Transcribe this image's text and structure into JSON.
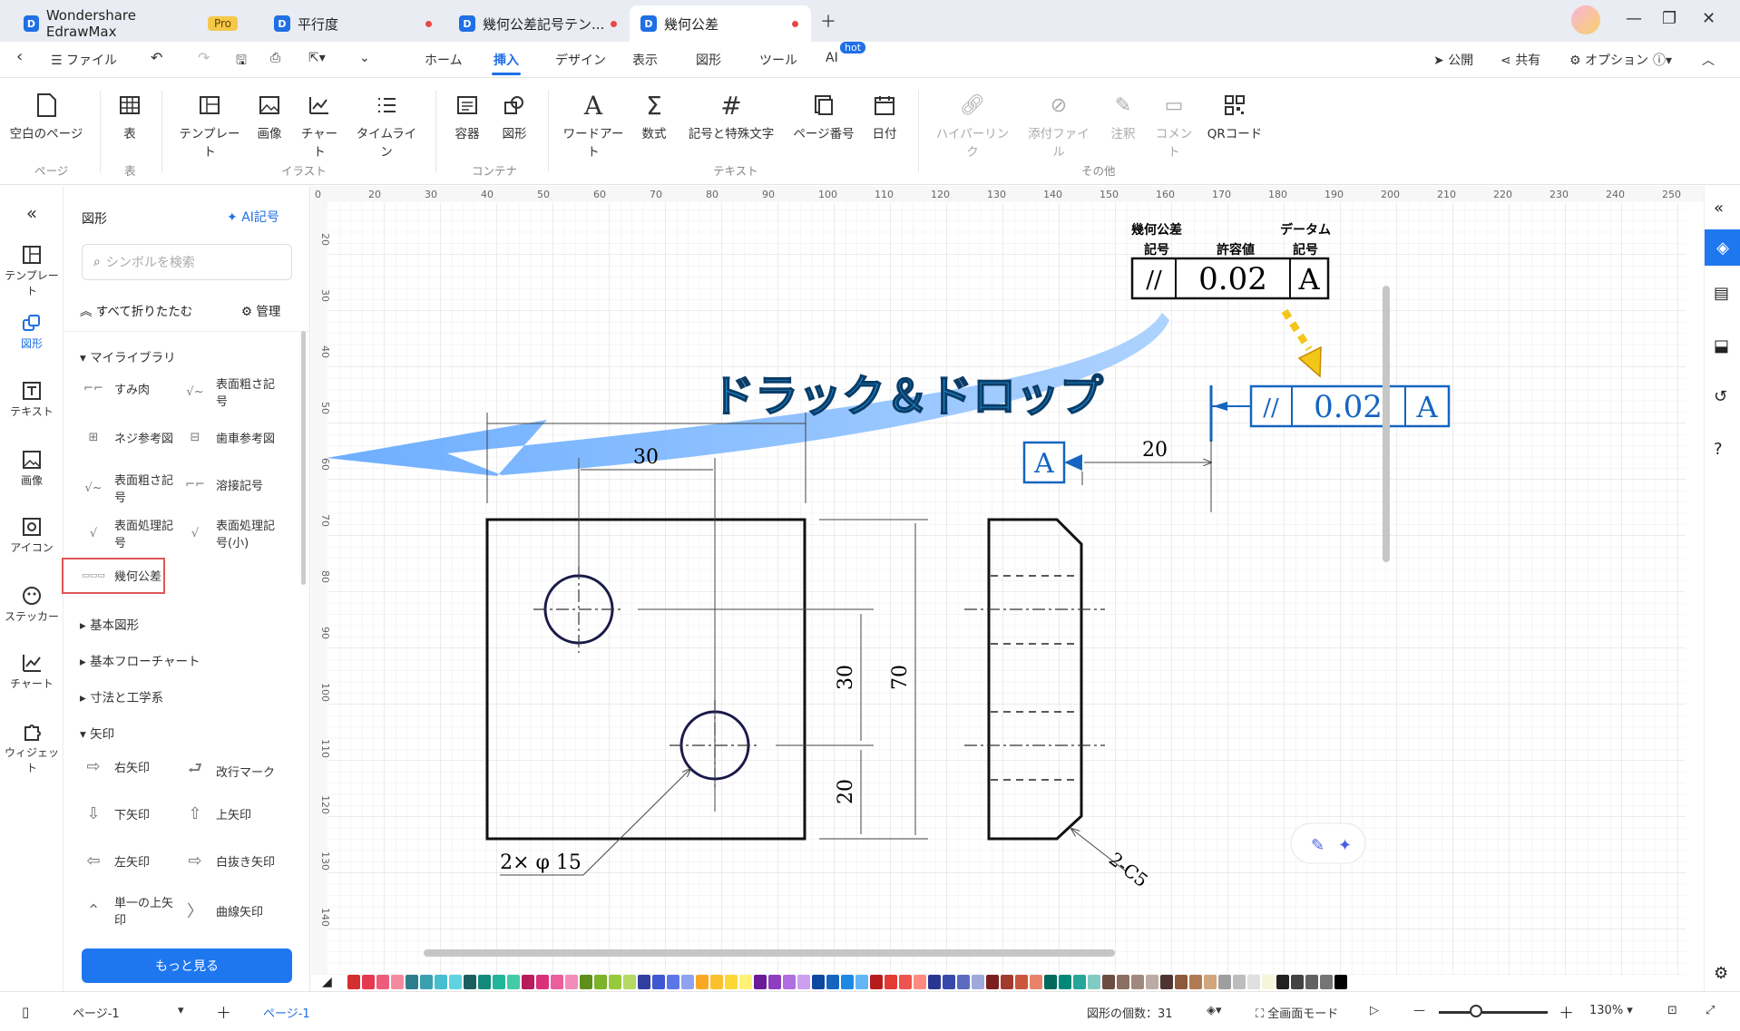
{
  "app": {
    "name": "Wondershare EdrawMax",
    "badge": "Pro",
    "tabs": [
      {
        "label": "平行度"
      },
      {
        "label": "幾何公差記号テン..."
      },
      {
        "label": "幾何公差"
      }
    ]
  },
  "menu": {
    "file": "ファイル",
    "items": [
      "ホーム",
      "挿入",
      "デザイン",
      "表示",
      "図形",
      "ツール",
      "AI"
    ],
    "ai_badge": "hot",
    "right": {
      "publish": "公開",
      "share": "共有",
      "options": "オプション"
    }
  },
  "ribbon": {
    "buttons": {
      "blank_page": "空白のページ",
      "table": "表",
      "template": "テンプレート",
      "image": "画像",
      "chart": "チャート",
      "timeline": "タイムライン",
      "container": "容器",
      "shape": "図形",
      "wordart": "ワードアート",
      "formula": "数式",
      "symbols": "記号と特殊文字",
      "page_number": "ページ番号",
      "date": "日付",
      "hyperlink": "ハイパーリンク",
      "attachment": "添付ファイル",
      "annotation": "注釈",
      "comment": "コメント",
      "qrcode": "QRコード"
    },
    "groups": {
      "page": "ページ",
      "table": "表",
      "illust": "イラスト",
      "container": "コンテナ",
      "text": "テキスト",
      "other": "その他"
    }
  },
  "leftbar": [
    "テンプレート",
    "図形",
    "テキスト",
    "画像",
    "アイコン",
    "ステッカー",
    "チャート",
    "ウィジェット"
  ],
  "panel": {
    "title": "図形",
    "ai_label": "AI記号",
    "search_placeholder": "シンボルを検索",
    "collapse_all": "すべて折りたたむ",
    "manage": "管理",
    "my_library": "マイライブラリ",
    "my_items": [
      "すみ肉",
      "表面粗さ記号",
      "ネジ参考図",
      "歯車参考図",
      "表面粗さ記号",
      "溶接記号",
      "表面処理記号",
      "表面処理記号(小)",
      "幾何公差"
    ],
    "sections": [
      "基本図形",
      "基本フローチャート",
      "寸法と工学系",
      "矢印"
    ],
    "arrow_items": [
      "右矢印",
      "改行マーク",
      "下矢印",
      "上矢印",
      "左矢印",
      "白抜き矢印",
      "単一の上矢印",
      "曲線矢印"
    ],
    "more": "もっと見る"
  },
  "ruler": {
    "h": [
      "0",
      "20",
      "30",
      "40",
      "50",
      "60",
      "70",
      "80",
      "90",
      "100",
      "110",
      "120",
      "130",
      "140",
      "150",
      "160",
      "170",
      "180",
      "190",
      "200",
      "210",
      "220",
      "230",
      "240",
      "250"
    ],
    "v": [
      "20",
      "30",
      "40",
      "50",
      "60",
      "70",
      "80",
      "90",
      "100",
      "110",
      "120",
      "130",
      "140"
    ]
  },
  "drawing": {
    "legend": {
      "symbol_label_1": "幾何公差",
      "symbol_label_2": "記号",
      "tolerance_label": "許容値",
      "datum_label_1": "データム",
      "datum_label_2": "記号"
    },
    "frame_symbol": "//",
    "frame_value": "0.02",
    "frame_datum": "A",
    "overlay_text": "ドラック＆ドロップ",
    "datum_box": "A",
    "dims": {
      "top_width": "30",
      "right_gap": "20",
      "v30": "30",
      "v70": "70",
      "v20": "20",
      "hole_note": "2× φ 15",
      "chamfer": "2-C5"
    }
  },
  "status": {
    "page_select": "ページ-1",
    "page_tab": "ページ-1",
    "shape_count": "図形の個数：31",
    "fullscreen": "全画面モード",
    "zoom": "130%"
  },
  "palette": [
    "#d32f2f",
    "#e53950",
    "#ef5b7a",
    "#f48aa0",
    "#2e7d8c",
    "#3aa0b0",
    "#47bdd0",
    "#60d3e0",
    "#1b5e60",
    "#138a7a",
    "#22b59a",
    "#43cba6",
    "#b71c5c",
    "#d8317a",
    "#ec5e9c",
    "#f28db8",
    "#5d8f1a",
    "#7cb32a",
    "#97c93c",
    "#b5d863",
    "#303f9f",
    "#3f57d0",
    "#5a77e8",
    "#8ea3f0",
    "#f9a825",
    "#fbc02d",
    "#fdd835",
    "#fff176",
    "#6a1b9a",
    "#8e3fc0",
    "#b06ee0",
    "#cc9ff0",
    "#0d47a1",
    "#1565c0",
    "#1e88e5",
    "#64b5f6",
    "#b71c1c",
    "#e53935",
    "#ef5350",
    "#ff8a80",
    "#283593",
    "#3949ab",
    "#5c6bc0",
    "#9fa8da",
    "#7b1f1f",
    "#a13b2b",
    "#c9573e",
    "#e8836a",
    "#00695c",
    "#00897b",
    "#26a69a",
    "#80cbc4",
    "#6d4c41",
    "#8d6e63",
    "#a1887f",
    "#bcaaa4",
    "#4e342e",
    "#8d5b3b",
    "#b07a55",
    "#d2a57f",
    "#9e9e9e",
    "#bdbdbd",
    "#e0e0e0",
    "#f5f5dc",
    "#212121",
    "#424242",
    "#616161",
    "#757575",
    "#000000"
  ]
}
